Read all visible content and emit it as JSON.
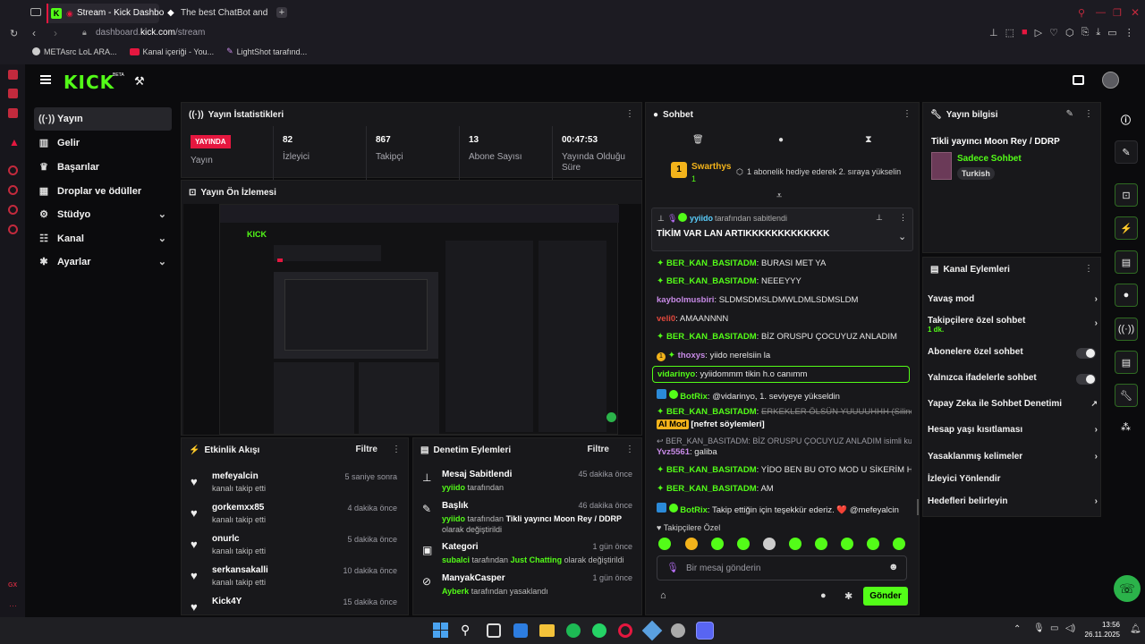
{
  "browser": {
    "tabs": [
      {
        "label": "Stream - Kick Dashbo",
        "active": true
      },
      {
        "label": "The best ChatBot and Wi",
        "active": false
      }
    ],
    "url_host": "dashboard.kick.com",
    "url_path": "/stream",
    "url_prefix": "dashboard.",
    "url_domain": "kick.com",
    "bookmarks": [
      "METAsrc LoL ARA...",
      "Kanal içeriği - You...",
      "LightShot tarafınd..."
    ]
  },
  "kick": {
    "logo": "KICK",
    "logo_beta": "BETA"
  },
  "nav": [
    {
      "label": "Yayın",
      "icon": "broadcast-icon",
      "active": true
    },
    {
      "label": "Gelir",
      "icon": "chart-icon"
    },
    {
      "label": "Başarılar",
      "icon": "trophy-icon"
    },
    {
      "label": "Droplar ve ödüller",
      "icon": "gift-icon"
    },
    {
      "label": "Stüdyo",
      "icon": "sliders-icon",
      "expandable": true
    },
    {
      "label": "Kanal",
      "icon": "users-icon",
      "expandable": true
    },
    {
      "label": "Ayarlar",
      "icon": "gear-icon",
      "expandable": true
    }
  ],
  "stats": {
    "title": "Yayın İstatistikleri",
    "live_badge": "YAYINDA",
    "live_label": "Yayın",
    "viewers_value": "82",
    "viewers_label": "İzleyici",
    "followers_value": "867",
    "followers_label": "Takipçi",
    "subs_value": "13",
    "subs_label": "Abone Sayısı",
    "uptime_value": "00:47:53",
    "uptime_label": "Yayında Olduğu Süre"
  },
  "preview": {
    "title": "Yayın Ön İzlemesi"
  },
  "activity": {
    "title": "Etkinlik Akışı",
    "filter": "Filtre",
    "items": [
      {
        "name": "mefeyalcin",
        "sub": "kanalı takip etti",
        "time": "5 saniye sonra"
      },
      {
        "name": "gorkemxx85",
        "sub": "kanalı takip etti",
        "time": "4 dakika önce"
      },
      {
        "name": "onurlc",
        "sub": "kanalı takip etti",
        "time": "5 dakika önce"
      },
      {
        "name": "serkansakalli",
        "sub": "kanalı takip etti",
        "time": "10 dakika önce"
      },
      {
        "name": "Kick4Y",
        "sub": "",
        "time": "15 dakika önce"
      }
    ]
  },
  "moderation": {
    "title": "Denetim Eylemleri",
    "filter": "Filtre",
    "items": [
      {
        "name": "Mesaj Sabitlendi",
        "time": "45 dakika önce",
        "actor": "yyiido",
        "text": "tarafından"
      },
      {
        "name": "Başlık",
        "time": "46 dakika önce",
        "actor": "yyiido",
        "text": "tarafından",
        "bold": "Tikli yayıncı Moon Rey / DDRP",
        "tail": "olarak değiştirildi"
      },
      {
        "name": "Kategori",
        "time": "1 gün önce",
        "actor": "subalci",
        "text": "tarafından",
        "green2": "Just Chatting",
        "tail": "olarak değiştirildi"
      },
      {
        "name": "ManyakCasper",
        "time": "1 gün önce",
        "actor": "Ayberk",
        "text": "tarafından yasaklandı"
      }
    ]
  },
  "chat": {
    "title": "Sohbet",
    "top_gifter": "Swarthys",
    "top_gifter_count": "1",
    "gift_notice": "1 abonelik hediye ederek 2. sıraya yükselin",
    "pinned_by": "yyiido",
    "pinned_by_text": "tarafından sabitlendi",
    "pinned_message": "TİKİM VAR LAN ARTIKKKKKKKKKKKKK",
    "messages": [
      {
        "user": "BER_KAN_BASITADM",
        "text": "BURASI MET YA"
      },
      {
        "user": "BER_KAN_BASITADM",
        "text": "NEEEYYY"
      },
      {
        "user": "kaybolmusbiri",
        "text": "SLDMSDMSLDMWLDMLSDMSLDM"
      },
      {
        "user": "veli0",
        "text": "AMAANNNN"
      },
      {
        "user": "BER_KAN_BASITADM",
        "text": "BİZ ORUSPU ÇOCUYUZ ANLADIM"
      },
      {
        "user": "thoxys",
        "text": "yiido nerelsiin la"
      },
      {
        "user": "vidarinyo",
        "text": "yyiidommm tikin h.o canımm"
      },
      {
        "user": "BotRix",
        "text": "@vidarinyo, 1. seviyeye yükseldin"
      },
      {
        "user": "BER_KAN_BASITADM",
        "text": "ERKEKLER ÖLSÜN YUUUUHHH (Silindi)"
      },
      {
        "badge": "AI Mod",
        "text": "[nefret söylemleri]"
      },
      {
        "reply": "BER_KAN_BASITADM: BİZ ORUSPU ÇOCUYUZ ANLADIM isimli kulla..."
      },
      {
        "user": "Yvz5561",
        "text": "galiba"
      },
      {
        "user": "BER_KAN_BASITADM",
        "text": "YİDO BEN BU OTO MOD U SİKERİM HA"
      },
      {
        "user": "BER_KAN_BASITADM",
        "text": "AM"
      },
      {
        "user": "BotRix",
        "text": "Takip ettiğin için teşekkür ederiz. ❤️ @mefeyalcin"
      }
    ],
    "emote_section": "Takipçilere Özel",
    "input_placeholder": "Bir mesaj gönderin",
    "send": "Gönder"
  },
  "stream_info": {
    "title": "Yayın bilgisi",
    "stream_title": "Tikli yayıncı Moon Rey / DDRP",
    "category": "Sadece Sohbet",
    "tag": "Turkish"
  },
  "channel_actions": {
    "title": "Kanal Eylemleri",
    "items": [
      {
        "label": "Yavaş mod",
        "type": "chevron"
      },
      {
        "label": "Takipçilere özel sohbet",
        "sub": "1 dk.",
        "type": "chevron"
      },
      {
        "label": "Abonelere özel sohbet",
        "type": "toggle"
      },
      {
        "label": "Yalnızca ifadelerle sohbet",
        "type": "toggle"
      },
      {
        "label": "Yapay Zeka ile Sohbet Denetimi",
        "type": "external"
      },
      {
        "label": "Hesap yaşı kısıtlaması",
        "type": "chevron"
      },
      {
        "label": "Yasaklanmış kelimeler",
        "type": "chevron"
      },
      {
        "label": "İzleyici Yönlendir",
        "type": "none"
      },
      {
        "label": "Hedefleri belirleyin",
        "type": "chevron"
      }
    ]
  },
  "taskbar": {
    "time": "13:56",
    "date": "26.11.2025"
  },
  "colors": {
    "accent": "#53fc18",
    "live": "#e5173f",
    "panel": "#18181b",
    "bg": "#0b0b0d"
  }
}
